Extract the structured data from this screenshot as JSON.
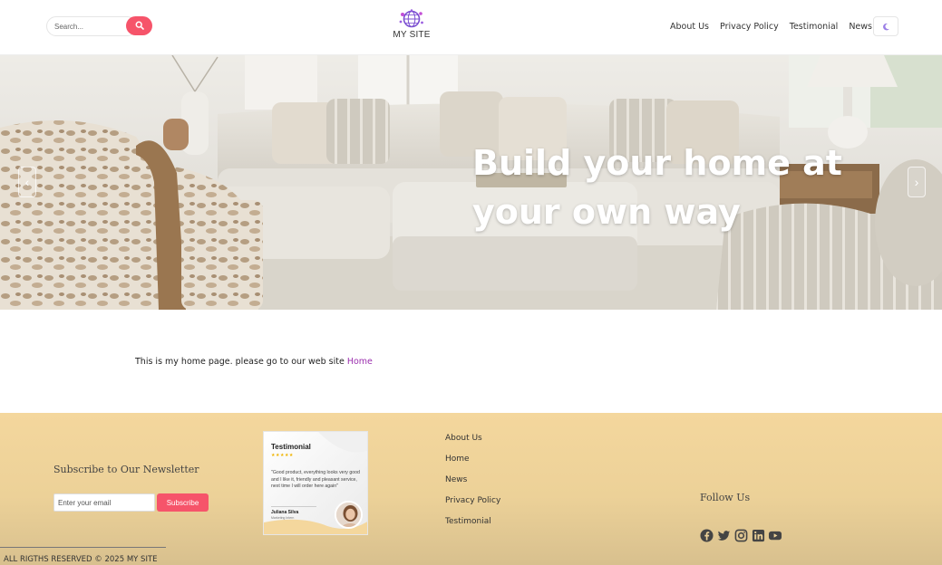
{
  "header": {
    "search_placeholder": "Search...",
    "site_name": "MY SITE",
    "nav": [
      "About Us",
      "Privacy Policy",
      "Testimonial",
      "News"
    ]
  },
  "hero": {
    "title": "Build your home at your own way",
    "prev": "‹",
    "next": "›"
  },
  "main": {
    "intro_text": "This is my home page. please go to our web site ",
    "intro_link": "Home"
  },
  "footer": {
    "newsletter_title": "Subscribe to Our Newsletter",
    "email_placeholder": "Enter your email",
    "subscribe_label": "Subscribe",
    "testimonial": {
      "title": "Testimonial",
      "stars": "★★★★★",
      "quote": "\"Good product, everything looks very good and I like it, friendly and pleasant service, next time I will order here again\"",
      "name": "Juliana Silva",
      "role": "Marketing Intern"
    },
    "links": [
      "About Us",
      "Home",
      "News",
      "Privacy Policy",
      "Testimonial"
    ],
    "follow_title": "Follow Us",
    "socials": [
      "facebook-icon",
      "twitter-icon",
      "instagram-icon",
      "linkedin-icon",
      "youtube-icon"
    ],
    "copyright": "ALL RIGTHS RESERVED © 2025 MY SITE"
  },
  "colors": {
    "accent": "#f6546a",
    "link": "#9b2fae",
    "footer_bg": "#f4d79d"
  }
}
